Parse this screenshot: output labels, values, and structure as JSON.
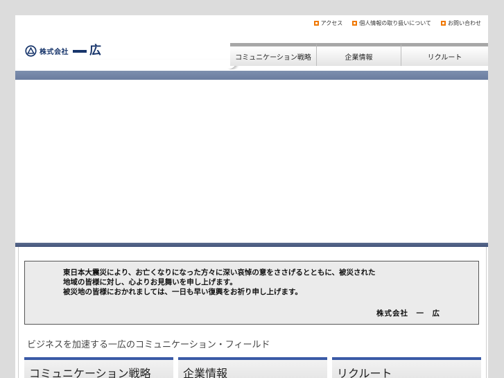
{
  "utility_links": [
    {
      "label": "アクセス",
      "icon": "orange-arrow-icon"
    },
    {
      "label": "個人情報の取り扱いについて",
      "icon": "orange-arrow-icon"
    },
    {
      "label": "お問い合わせ",
      "icon": "orange-arrow-icon"
    }
  ],
  "logo": {
    "company": "株式会社",
    "name": "広",
    "mark": "circle-triangle-logo"
  },
  "nav": [
    {
      "label": "コミュニケーション戦略"
    },
    {
      "label": "企業情報"
    },
    {
      "label": "リクルート"
    }
  ],
  "notice": {
    "lines": [
      "東日本大震災により、お亡くなりになった方々に深い哀悼の意をささげるとともに、被災された",
      "地域の皆様に対し、心よりお見舞いを申し上げます。",
      "被災地の皆様におかれましては、一日も早い復興をお祈り申し上げます。"
    ],
    "signature": "株式会社　一　広"
  },
  "catchphrase": "ビジネスを加速する一広のコミュニケーション・フィールド",
  "sections": [
    {
      "label": "コミュニケーション戦略"
    },
    {
      "label": "企業情報"
    },
    {
      "label": "リクルート"
    }
  ],
  "colors": {
    "accent": "#f07800",
    "brand": "#17356b",
    "band": "#6a7d9f",
    "section_bar": "#3a5aa6"
  }
}
